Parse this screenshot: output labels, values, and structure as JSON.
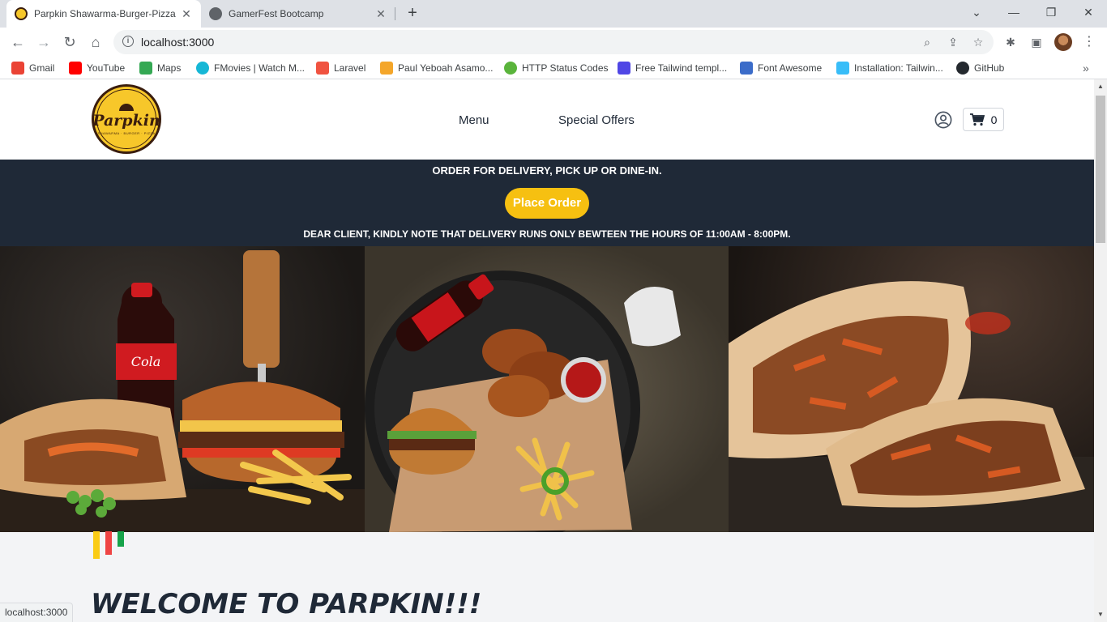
{
  "browser": {
    "tabs": [
      {
        "title": "Parpkin Shawarma-Burger-Pizza",
        "close": "✕"
      },
      {
        "title": "GamerFest Bootcamp",
        "close": "✕"
      }
    ],
    "new_tab": "+",
    "window_controls": {
      "chevron": "⌄",
      "minimize": "—",
      "restore": "❐",
      "close": "✕"
    },
    "url": "localhost:3000",
    "nav_glyphs": {
      "back": "←",
      "forward": "→",
      "reload": "↻",
      "home": "⌂"
    },
    "bookmarks": [
      {
        "label": "Gmail",
        "color": "#ea4335"
      },
      {
        "label": "YouTube",
        "color": "#ff0000"
      },
      {
        "label": "Maps",
        "color": "#34a853"
      },
      {
        "label": "FMovies | Watch M...",
        "color": "#16b7d6"
      },
      {
        "label": "Laravel",
        "color": "#f05340"
      },
      {
        "label": "Paul Yeboah Asamo...",
        "color": "#f4a62a"
      },
      {
        "label": "HTTP Status Codes",
        "color": "#5ab43c"
      },
      {
        "label": "Free Tailwind templ...",
        "color": "#4f46e5"
      },
      {
        "label": "Font Awesome",
        "color": "#3b6cc9"
      },
      {
        "label": "Installation: Tailwin...",
        "color": "#38bdf8"
      },
      {
        "label": "GitHub",
        "color": "#24292f"
      }
    ],
    "bookmarks_more": "»",
    "status_url": "localhost:3000"
  },
  "site": {
    "logo": {
      "name": "Parpkin",
      "tagline": "SHAWARMA · BURGER · PIZZA"
    },
    "nav": [
      {
        "label": "Menu"
      },
      {
        "label": "Special Offers"
      }
    ],
    "cart_count": "0",
    "banner": {
      "headline": "ORDER FOR DELIVERY, PICK UP OR DINE-IN.",
      "cta": "Place Order",
      "notice": "DEAR CLIENT, KINDLY NOTE THAT DELIVERY RUNS ONLY BEWTEEN THE HOURS OF 11:00AM - 8:00PM."
    },
    "hero_images": [
      "shawarma-burger-coke",
      "fried-chicken-burger-platter",
      "shawarma-wrap"
    ],
    "accent_colors": [
      "#facc15",
      "#ef4444",
      "#16a34a"
    ],
    "welcome": "WELCOME TO PARPKIN!!!"
  },
  "colors": {
    "banner_bg": "#1f2937",
    "cta_bg": "#f6c011",
    "brand_yellow": "#f7c72a",
    "brand_brown": "#3a1d0e"
  }
}
